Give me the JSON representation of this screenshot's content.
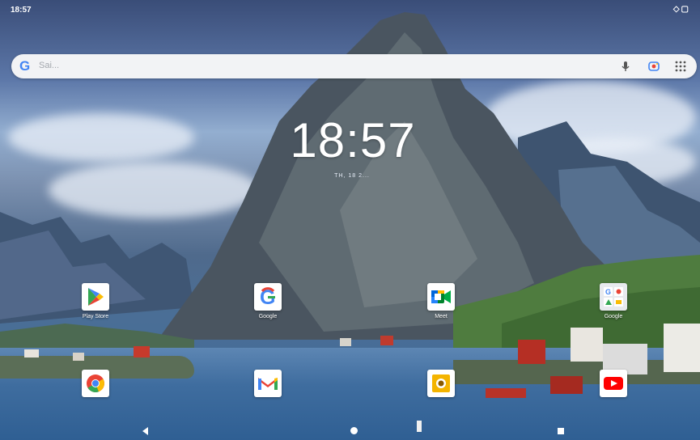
{
  "status_bar": {
    "time": "18:57",
    "icons": "◇▢"
  },
  "search": {
    "logo": "G",
    "placeholder": "Sai..."
  },
  "clock": {
    "time": "18:57",
    "date": "TH, 18 2..."
  },
  "apps_row1": [
    {
      "label": "Play Store",
      "icon": "play-store-icon"
    },
    {
      "label": "Google",
      "icon": "google-icon"
    },
    {
      "label": "Meet",
      "icon": "meet-icon"
    },
    {
      "label": "Google",
      "icon": "google-folder-icon"
    }
  ],
  "apps_row2": [
    {
      "label": "",
      "icon": "chrome-icon"
    },
    {
      "label": "",
      "icon": "gmail-icon"
    },
    {
      "label": "",
      "icon": "camera-icon"
    },
    {
      "label": "",
      "icon": "youtube-icon"
    }
  ],
  "colors": {
    "google_blue": "#4285F4",
    "google_red": "#EA4335",
    "google_yellow": "#FBBC05",
    "google_green": "#34A853"
  }
}
